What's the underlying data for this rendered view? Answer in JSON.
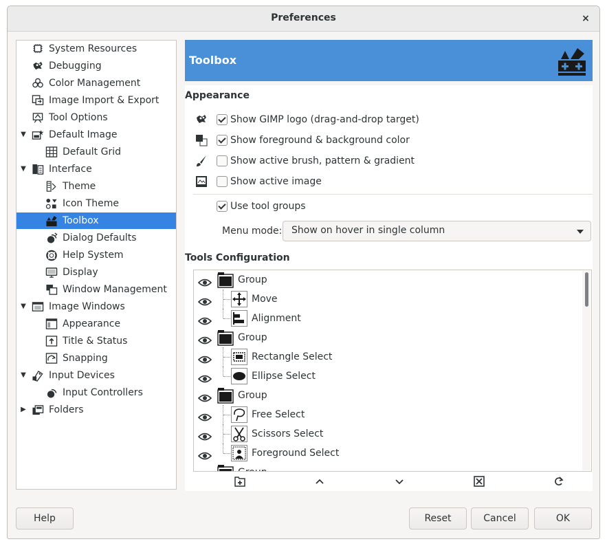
{
  "window": {
    "title": "Preferences",
    "close_glyph": "×"
  },
  "sidebar": {
    "items": [
      {
        "label": "System Resources",
        "icon": "chip-icon",
        "indent": 0,
        "expander": ""
      },
      {
        "label": "Debugging",
        "icon": "wilber-icon",
        "indent": 0,
        "expander": ""
      },
      {
        "label": "Color Management",
        "icon": "color-circles-icon",
        "indent": 0,
        "expander": ""
      },
      {
        "label": "Image Import & Export",
        "icon": "import-export-icon",
        "indent": 0,
        "expander": ""
      },
      {
        "label": "Tool Options",
        "icon": "tool-options-icon",
        "indent": 0,
        "expander": ""
      },
      {
        "label": "Default Image",
        "icon": "default-image-icon",
        "indent": 0,
        "expander": "▼"
      },
      {
        "label": "Default Grid",
        "icon": "grid-icon",
        "indent": 1,
        "expander": ""
      },
      {
        "label": "Interface",
        "icon": "interface-icon",
        "indent": 0,
        "expander": "▼"
      },
      {
        "label": "Theme",
        "icon": "theme-icon",
        "indent": 1,
        "expander": ""
      },
      {
        "label": "Icon Theme",
        "icon": "icon-theme-icon",
        "indent": 1,
        "expander": ""
      },
      {
        "label": "Toolbox",
        "icon": "toolbox-icon",
        "indent": 1,
        "expander": "",
        "selected": true
      },
      {
        "label": "Dialog Defaults",
        "icon": "dialog-defaults-icon",
        "indent": 1,
        "expander": ""
      },
      {
        "label": "Help System",
        "icon": "lifebuoy-icon",
        "indent": 1,
        "expander": ""
      },
      {
        "label": "Display",
        "icon": "display-icon",
        "indent": 1,
        "expander": ""
      },
      {
        "label": "Window Management",
        "icon": "window-management-icon",
        "indent": 1,
        "expander": ""
      },
      {
        "label": "Image Windows",
        "icon": "image-windows-icon",
        "indent": 0,
        "expander": "▼"
      },
      {
        "label": "Appearance",
        "icon": "appearance-icon",
        "indent": 1,
        "expander": ""
      },
      {
        "label": "Title & Status",
        "icon": "title-status-icon",
        "indent": 1,
        "expander": ""
      },
      {
        "label": "Snapping",
        "icon": "snapping-icon",
        "indent": 1,
        "expander": ""
      },
      {
        "label": "Input Devices",
        "icon": "input-devices-icon",
        "indent": 0,
        "expander": "▼"
      },
      {
        "label": "Input Controllers",
        "icon": "input-controllers-icon",
        "indent": 1,
        "expander": ""
      },
      {
        "label": "Folders",
        "icon": "folders-icon",
        "indent": 0,
        "expander": "▶"
      }
    ]
  },
  "header": {
    "title": "Toolbox",
    "icon": "toolbox-icon",
    "bg_color": "#4a90d9"
  },
  "appearance": {
    "section_label": "Appearance",
    "options": [
      {
        "label": "Show GIMP logo (drag-and-drop target)",
        "checked": true,
        "icon": "wilber-icon"
      },
      {
        "label": "Show foreground & background color",
        "checked": true,
        "icon": "fg-bg-color-icon"
      },
      {
        "label": "Show active brush, pattern & gradient",
        "checked": false,
        "icon": "brush-icon"
      },
      {
        "label": "Show active image",
        "checked": false,
        "icon": "active-image-icon"
      }
    ],
    "use_tool_groups": {
      "label": "Use tool groups",
      "checked": true
    },
    "menu_mode": {
      "label": "Menu mode:",
      "value": "Show on hover in single column"
    }
  },
  "tools_config": {
    "section_label": "Tools Configuration",
    "rows": [
      {
        "label": "Group",
        "type": "group",
        "icon": "folder-icon"
      },
      {
        "label": "Move",
        "type": "tool",
        "icon": "move-icon"
      },
      {
        "label": "Alignment",
        "type": "tool",
        "icon": "alignment-icon",
        "last": true
      },
      {
        "label": "Group",
        "type": "group",
        "icon": "folder-icon"
      },
      {
        "label": "Rectangle Select",
        "type": "tool",
        "icon": "rect-select-icon"
      },
      {
        "label": "Ellipse Select",
        "type": "tool",
        "icon": "ellipse-select-icon",
        "last": true
      },
      {
        "label": "Group",
        "type": "group",
        "icon": "folder-icon"
      },
      {
        "label": "Free Select",
        "type": "tool",
        "icon": "free-select-icon"
      },
      {
        "label": "Scissors Select",
        "type": "tool",
        "icon": "scissors-icon"
      },
      {
        "label": "Foreground Select",
        "type": "tool",
        "icon": "foreground-select-icon",
        "last": true
      },
      {
        "label": "Group",
        "type": "group",
        "icon": "folder-icon"
      }
    ],
    "buttons": [
      {
        "name": "new-group-button",
        "icon": "new-group-icon"
      },
      {
        "name": "raise-button",
        "icon": "chevron-up-icon",
        "glyph": "︿"
      },
      {
        "name": "lower-button",
        "icon": "chevron-down-icon",
        "glyph": "﹀"
      },
      {
        "name": "delete-button",
        "icon": "delete-icon"
      },
      {
        "name": "reset-tools-button",
        "icon": "reset-icon"
      }
    ]
  },
  "footer": {
    "help": "Help",
    "reset": "Reset",
    "cancel": "Cancel",
    "ok": "OK"
  }
}
